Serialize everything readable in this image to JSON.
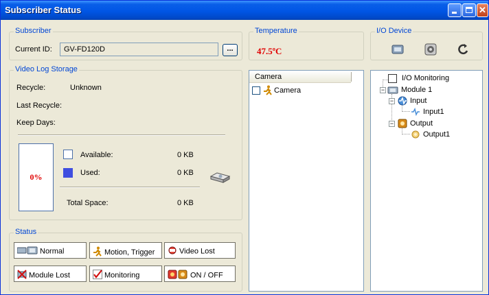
{
  "window": {
    "title": "Subscriber Status",
    "controls": [
      "minimize",
      "maximize",
      "close"
    ]
  },
  "subscriber": {
    "legend": "Subscriber",
    "current_id_label": "Current ID:",
    "current_id_value": "GV-FD120D",
    "browse_label": "..."
  },
  "temperature": {
    "legend": "Temperature",
    "value": "47.5ºC"
  },
  "io_device": {
    "legend": "I/O Device",
    "icons": [
      "io-box-icon",
      "speaker-icon",
      "refresh-icon"
    ]
  },
  "storage": {
    "legend": "Video Log Storage",
    "recycle_label": "Recycle:",
    "recycle_value": "Unknown",
    "last_recycle_label": "Last Recycle:",
    "keep_days_label": "Keep Days:",
    "usage_percent": "0%",
    "available_label": "Available:",
    "available_value": "0 KB",
    "used_label": "Used:",
    "used_value": "0 KB",
    "total_label": "Total Space:",
    "total_value": "0 KB",
    "colors": {
      "available": "#ffffff",
      "used": "#3f4ee0"
    }
  },
  "camera_list": {
    "header": "Camera",
    "items": [
      {
        "label": "Camera",
        "checked": false
      }
    ]
  },
  "io_tree": {
    "root": "I/O Monitoring",
    "module": "Module 1",
    "input": "Input",
    "input_child": "Input1",
    "output": "Output",
    "output_child": "Output1"
  },
  "status": {
    "legend": "Status",
    "items": [
      "Normal",
      "Motion, Trigger",
      "Video Lost",
      "Module Lost",
      "Monitoring",
      "ON / OFF"
    ]
  }
}
